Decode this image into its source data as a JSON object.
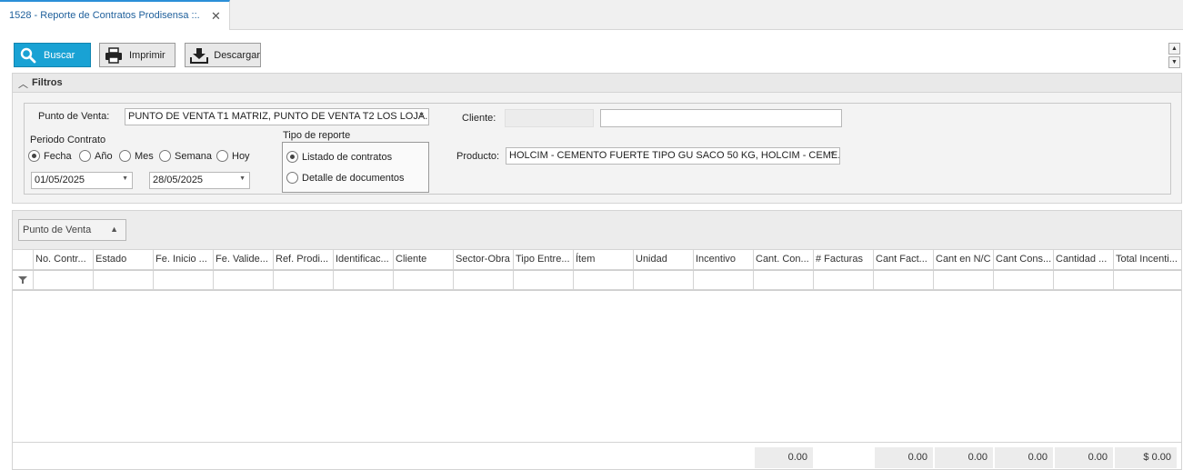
{
  "tab": {
    "title": "1528 - Reporte de Contratos Prodisensa ::.",
    "close": "✕"
  },
  "toolbar": {
    "search_label": "Buscar",
    "print_label": "Imprimir",
    "download_label": "Descargar",
    "search_icon": "search-icon",
    "print_icon": "printer-icon",
    "download_icon": "download-icon",
    "accent_color": "#19a2d4"
  },
  "filters": {
    "title": "Filtros",
    "punto_venta_label": "Punto de Venta:",
    "punto_venta_value": "PUNTO DE VENTA T1 MATRIZ, PUNTO DE VENTA T2  LOS LOJA...",
    "periodo_label": "Periodo Contrato",
    "periodo_options": [
      "Fecha",
      "Año",
      "Mes",
      "Semana",
      "Hoy"
    ],
    "periodo_selected": "Fecha",
    "fecha_desde": "01/05/2025",
    "fecha_hasta": "28/05/2025",
    "tipo_reporte_label": "Tipo de reporte",
    "tipo_reporte_options": [
      "Listado de contratos",
      "Detalle de documentos"
    ],
    "tipo_reporte_selected": "Listado de contratos",
    "cliente_label": "Cliente:",
    "cliente_code": "",
    "cliente_name": "",
    "producto_label": "Producto:",
    "producto_value": "HOLCIM  - CEMENTO FUERTE TIPO GU SACO 50 KG, HOLCIM  - CEME..."
  },
  "grid": {
    "group_by_chip": "Punto de Venta",
    "columns": [
      "No. Contr...",
      "Estado",
      "Fe. Inicio ...",
      "Fe. Valide...",
      "Ref. Prodi...",
      "Identificac...",
      "Cliente",
      "Sector-Obra",
      "Tipo Entre...",
      "Ítem",
      "Unidad",
      "Incentivo",
      "Cant. Con...",
      "# Facturas",
      "Cant Fact...",
      "Cant en N/C",
      "Cant Cons...",
      "Cantidad ...",
      "Total Incenti..."
    ],
    "totals": {
      "cant_con": "0.00",
      "cant_fact": "0.00",
      "cant_nc": "0.00",
      "cant_cons": "0.00",
      "cantidad": "0.00",
      "total_incentivo": "$ 0.00"
    }
  }
}
